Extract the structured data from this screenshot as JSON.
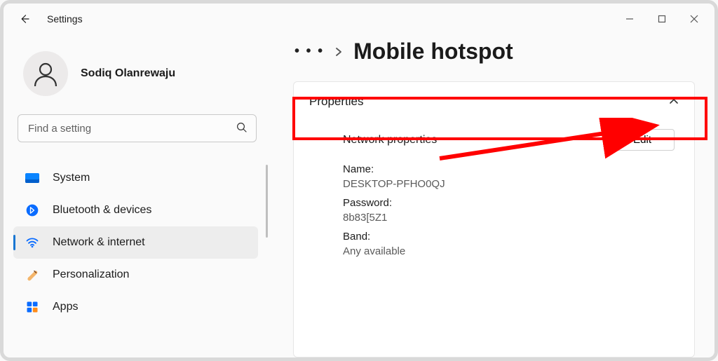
{
  "titlebar": {
    "title": "Settings"
  },
  "account": {
    "name": "Sodiq Olanrewaju"
  },
  "search": {
    "placeholder": "Find a setting"
  },
  "nav": {
    "items": [
      {
        "label": "System"
      },
      {
        "label": "Bluetooth & devices"
      },
      {
        "label": "Network & internet"
      },
      {
        "label": "Personalization"
      },
      {
        "label": "Apps"
      }
    ],
    "selected_index": 2
  },
  "breadcrumb": {
    "ellipsis": "• • •",
    "current": "Mobile hotspot"
  },
  "card": {
    "header": "Properties",
    "section_title": "Network properties",
    "edit_label": "Edit",
    "fields": {
      "name_label": "Name:",
      "name_value": "DESKTOP-PFHO0QJ",
      "password_label": "Password:",
      "password_value": "8b83[5Z1",
      "band_label": "Band:",
      "band_value": "Any available"
    }
  }
}
